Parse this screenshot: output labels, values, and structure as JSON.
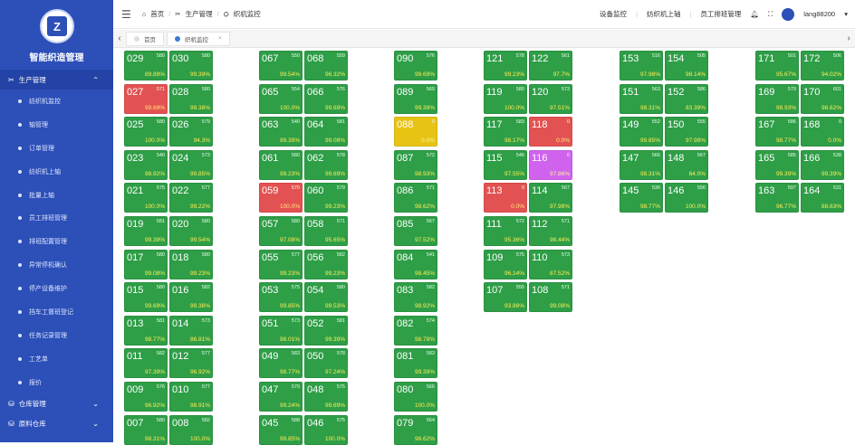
{
  "sidebar": {
    "app_title": "智能织造管理",
    "groups": [
      {
        "label": "生产管理",
        "arrow": "^"
      },
      {
        "label": "仓库管理",
        "arrow": "v"
      },
      {
        "label": "原料仓库",
        "arrow": "v"
      }
    ],
    "items": [
      "纺织机监控",
      "轴管理",
      "订单管理",
      "纺织机上轴",
      "批量上轴",
      "员工排班管理",
      "排班配置管理",
      "异常停机确认",
      "停产设备维护",
      "挡车工督班登记",
      "任务记录管理",
      "工艺单",
      "报价"
    ]
  },
  "header": {
    "breadcrumb": [
      "首页",
      "生产管理",
      "织机监控"
    ],
    "links": [
      "设备监控",
      "纺织机上轴",
      "员工排班管理"
    ],
    "user": "lang88200"
  },
  "tabs": [
    {
      "label": "首页",
      "active": false
    },
    {
      "label": "织机监控",
      "active": true
    }
  ],
  "colors": {
    "normal": "#2e9e47",
    "stopped": "#e35252",
    "warning": "#e7c314",
    "special": "#cf63ee"
  },
  "machines": [
    {
      "id": "029",
      "top": "580",
      "pct": "89.89%",
      "status": "normal"
    },
    {
      "id": "030",
      "top": "580",
      "pct": "99.39%",
      "status": "normal"
    },
    {
      "id": "027",
      "top": "571",
      "pct": "99.69%",
      "status": "stopped"
    },
    {
      "id": "028",
      "top": "580",
      "pct": "99.38%",
      "status": "normal"
    },
    {
      "id": "025",
      "top": "580",
      "pct": "100.0%",
      "status": "normal"
    },
    {
      "id": "026",
      "top": "579",
      "pct": "94.3%",
      "status": "normal"
    },
    {
      "id": "023",
      "top": "540",
      "pct": "98.92%",
      "status": "normal"
    },
    {
      "id": "024",
      "top": "573",
      "pct": "99.85%",
      "status": "normal"
    },
    {
      "id": "021",
      "top": "575",
      "pct": "100.0%",
      "status": "normal"
    },
    {
      "id": "022",
      "top": "577",
      "pct": "99.22%",
      "status": "normal"
    },
    {
      "id": "019",
      "top": "581",
      "pct": "99.39%",
      "status": "normal"
    },
    {
      "id": "020",
      "top": "580",
      "pct": "99.54%",
      "status": "normal"
    },
    {
      "id": "017",
      "top": "580",
      "pct": "99.08%",
      "status": "normal"
    },
    {
      "id": "018",
      "top": "580",
      "pct": "99.23%",
      "status": "normal"
    },
    {
      "id": "015",
      "top": "580",
      "pct": "99.69%",
      "status": "normal"
    },
    {
      "id": "016",
      "top": "582",
      "pct": "99.38%",
      "status": "normal"
    },
    {
      "id": "013",
      "top": "581",
      "pct": "98.77%",
      "status": "normal"
    },
    {
      "id": "014",
      "top": "573",
      "pct": "86.81%",
      "status": "normal"
    },
    {
      "id": "011",
      "top": "582",
      "pct": "97.39%",
      "status": "normal"
    },
    {
      "id": "012",
      "top": "577",
      "pct": "96.92%",
      "status": "normal"
    },
    {
      "id": "009",
      "top": "576",
      "pct": "96.92%",
      "status": "normal"
    },
    {
      "id": "010",
      "top": "577",
      "pct": "98.91%",
      "status": "normal"
    },
    {
      "id": "007",
      "top": "580",
      "pct": "98.31%",
      "status": "normal"
    },
    {
      "id": "008",
      "top": "582",
      "pct": "100.0%",
      "status": "normal"
    },
    {
      "id": "067",
      "top": "550",
      "pct": "99.54%",
      "status": "normal"
    },
    {
      "id": "068",
      "top": "559",
      "pct": "96.32%",
      "status": "normal"
    },
    {
      "id": "065",
      "top": "554",
      "pct": "100.0%",
      "status": "normal"
    },
    {
      "id": "066",
      "top": "576",
      "pct": "99.69%",
      "status": "normal"
    },
    {
      "id": "063",
      "top": "540",
      "pct": "99.39%",
      "status": "normal"
    },
    {
      "id": "064",
      "top": "581",
      "pct": "99.08%",
      "status": "normal"
    },
    {
      "id": "061",
      "top": "580",
      "pct": "99.23%",
      "status": "normal"
    },
    {
      "id": "062",
      "top": "578",
      "pct": "99.69%",
      "status": "normal"
    },
    {
      "id": "059",
      "top": "570",
      "pct": "100.0%",
      "status": "stopped"
    },
    {
      "id": "060",
      "top": "579",
      "pct": "99.23%",
      "status": "normal"
    },
    {
      "id": "057",
      "top": "580",
      "pct": "97.08%",
      "status": "normal"
    },
    {
      "id": "058",
      "top": "571",
      "pct": "95.65%",
      "status": "normal"
    },
    {
      "id": "055",
      "top": "577",
      "pct": "99.23%",
      "status": "normal"
    },
    {
      "id": "056",
      "top": "582",
      "pct": "99.23%",
      "status": "normal"
    },
    {
      "id": "053",
      "top": "575",
      "pct": "99.85%",
      "status": "normal"
    },
    {
      "id": "054",
      "top": "580",
      "pct": "99.53%",
      "status": "normal"
    },
    {
      "id": "051",
      "top": "573",
      "pct": "98.01%",
      "status": "normal"
    },
    {
      "id": "052",
      "top": "581",
      "pct": "99.39%",
      "status": "normal"
    },
    {
      "id": "049",
      "top": "583",
      "pct": "98.77%",
      "status": "normal"
    },
    {
      "id": "050",
      "top": "578",
      "pct": "97.24%",
      "status": "normal"
    },
    {
      "id": "047",
      "top": "579",
      "pct": "99.24%",
      "status": "normal"
    },
    {
      "id": "048",
      "top": "575",
      "pct": "99.69%",
      "status": "normal"
    },
    {
      "id": "045",
      "top": "588",
      "pct": "99.85%",
      "status": "normal"
    },
    {
      "id": "046",
      "top": "575",
      "pct": "100.0%",
      "status": "normal"
    },
    {
      "id": "090",
      "top": "576",
      "pct": "99.69%",
      "status": "normal"
    },
    {
      "id": "089",
      "top": "569",
      "pct": "99.39%",
      "status": "normal"
    },
    {
      "id": "088",
      "top": "0",
      "pct": "0.0%",
      "status": "warning"
    },
    {
      "id": "087",
      "top": "572",
      "pct": "98.93%",
      "status": "normal"
    },
    {
      "id": "086",
      "top": "571",
      "pct": "98.62%",
      "status": "normal"
    },
    {
      "id": "085",
      "top": "567",
      "pct": "97.52%",
      "status": "normal"
    },
    {
      "id": "084",
      "top": "541",
      "pct": "98.45%",
      "status": "normal"
    },
    {
      "id": "083",
      "top": "582",
      "pct": "98.92%",
      "status": "normal"
    },
    {
      "id": "082",
      "top": "574",
      "pct": "98.78%",
      "status": "normal"
    },
    {
      "id": "081",
      "top": "583",
      "pct": "99.39%",
      "status": "normal"
    },
    {
      "id": "080",
      "top": "566",
      "pct": "100.0%",
      "status": "normal"
    },
    {
      "id": "079",
      "top": "564",
      "pct": "98.62%",
      "status": "normal"
    },
    {
      "id": "121",
      "top": "578",
      "pct": "99.23%",
      "status": "normal"
    },
    {
      "id": "122",
      "top": "561",
      "pct": "97.7%",
      "status": "normal"
    },
    {
      "id": "119",
      "top": "580",
      "pct": "100.0%",
      "status": "normal"
    },
    {
      "id": "120",
      "top": "573",
      "pct": "97.51%",
      "status": "normal"
    },
    {
      "id": "117",
      "top": "583",
      "pct": "98.17%",
      "status": "normal"
    },
    {
      "id": "118",
      "top": "0",
      "pct": "0.0%",
      "status": "stopped"
    },
    {
      "id": "115",
      "top": "546",
      "pct": "97.55%",
      "status": "normal"
    },
    {
      "id": "116",
      "top": "0",
      "pct": "97.86%",
      "status": "special"
    },
    {
      "id": "113",
      "top": "0",
      "pct": "0.0%",
      "status": "stopped"
    },
    {
      "id": "114",
      "top": "567",
      "pct": "97.98%",
      "status": "normal"
    },
    {
      "id": "111",
      "top": "572",
      "pct": "95.36%",
      "status": "normal"
    },
    {
      "id": "112",
      "top": "571",
      "pct": "98.44%",
      "status": "normal"
    },
    {
      "id": "109",
      "top": "575",
      "pct": "96.14%",
      "status": "normal"
    },
    {
      "id": "110",
      "top": "573",
      "pct": "87.52%",
      "status": "normal"
    },
    {
      "id": "107",
      "top": "555",
      "pct": "93.86%",
      "status": "normal"
    },
    {
      "id": "108",
      "top": "571",
      "pct": "99.08%",
      "status": "normal"
    },
    {
      "id": "153",
      "top": "516",
      "pct": "97.98%",
      "status": "normal"
    },
    {
      "id": "154",
      "top": "505",
      "pct": "98.14%",
      "status": "normal"
    },
    {
      "id": "151",
      "top": "563",
      "pct": "98.31%",
      "status": "normal"
    },
    {
      "id": "152",
      "top": "586",
      "pct": "83.39%",
      "status": "normal"
    },
    {
      "id": "149",
      "top": "552",
      "pct": "99.85%",
      "status": "normal"
    },
    {
      "id": "150",
      "top": "555",
      "pct": "97.98%",
      "status": "normal"
    },
    {
      "id": "147",
      "top": "566",
      "pct": "98.31%",
      "status": "normal"
    },
    {
      "id": "148",
      "top": "567",
      "pct": "64.0%",
      "status": "normal"
    },
    {
      "id": "145",
      "top": "536",
      "pct": "98.77%",
      "status": "normal"
    },
    {
      "id": "146",
      "top": "556",
      "pct": "100.0%",
      "status": "normal"
    },
    {
      "id": "171",
      "top": "501",
      "pct": "95.67%",
      "status": "normal"
    },
    {
      "id": "172",
      "top": "506",
      "pct": "94.02%",
      "status": "normal"
    },
    {
      "id": "169",
      "top": "579",
      "pct": "98.93%",
      "status": "normal"
    },
    {
      "id": "170",
      "top": "601",
      "pct": "98.62%",
      "status": "normal"
    },
    {
      "id": "167",
      "top": "586",
      "pct": "98.77%",
      "status": "normal"
    },
    {
      "id": "168",
      "top": "0",
      "pct": "0.0%",
      "status": "normal"
    },
    {
      "id": "165",
      "top": "585",
      "pct": "99.39%",
      "status": "normal"
    },
    {
      "id": "166",
      "top": "538",
      "pct": "99.39%",
      "status": "normal"
    },
    {
      "id": "163",
      "top": "597",
      "pct": "96.77%",
      "status": "normal"
    },
    {
      "id": "164",
      "top": "531",
      "pct": "88.63%",
      "status": "normal"
    }
  ]
}
